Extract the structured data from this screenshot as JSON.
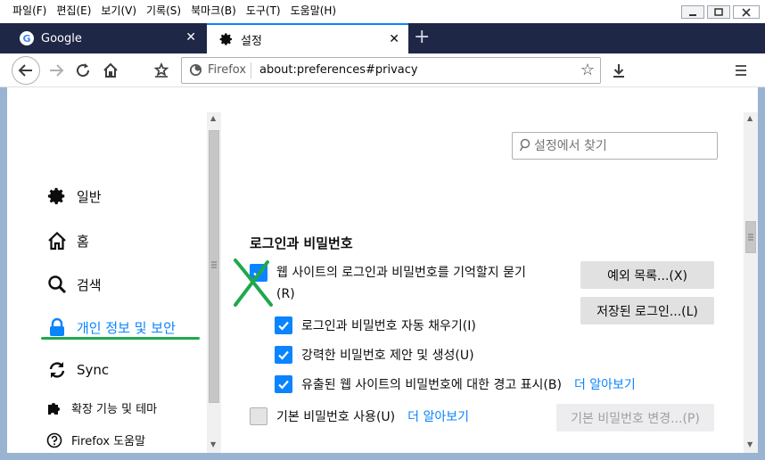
{
  "menubar": {
    "items": [
      "파일(F)",
      "편집(E)",
      "보기(V)",
      "기록(S)",
      "북마크(B)",
      "도구(T)",
      "도움말(H)"
    ]
  },
  "tabs": [
    {
      "label": "Google",
      "icon": "google-icon",
      "active": false
    },
    {
      "label": "설정",
      "icon": "gear-icon",
      "active": true
    }
  ],
  "urlbar": {
    "identity": "Firefox",
    "url": "about:preferences#privacy"
  },
  "sidebar": {
    "items": [
      {
        "label": "일반",
        "icon": "gear-icon"
      },
      {
        "label": "홈",
        "icon": "home-icon"
      },
      {
        "label": "검색",
        "icon": "search-icon"
      },
      {
        "label": "개인 정보 및 보안",
        "icon": "lock-icon",
        "selected": true
      },
      {
        "label": "Sync",
        "icon": "sync-icon"
      },
      {
        "label": "확장 기능 및 테마",
        "icon": "puzzle-icon"
      },
      {
        "label": "Firefox 도움말",
        "icon": "help-icon"
      }
    ]
  },
  "search": {
    "placeholder": "설정에서 찾기"
  },
  "logins": {
    "title": "로그인과 비밀번호",
    "ask_to_save": {
      "line1": "웹 사이트의 로그인과 비밀번호를 기억할지 묻기",
      "line2": "(R)",
      "checked": true
    },
    "autofill": {
      "label": "로그인과 비밀번호 자동 채우기(I)",
      "checked": true
    },
    "suggest": {
      "label": "강력한 비밀번호 제안 및 생성(U)",
      "checked": true
    },
    "breach": {
      "label": "유출된 웹 사이트의 비밀번호에 대한 경고 표시(B)",
      "checked": true,
      "link": "더 알아보기"
    },
    "primary_password": {
      "label": "기본 비밀번호 사용(U)",
      "checked": false,
      "link": "더 알아보기"
    },
    "exceptions_button": "예외 목록...(X)",
    "saved_logins_button": "저장된 로그인...(L)",
    "change_password_button": "기본 비밀번호 변경...(P)"
  },
  "colors": {
    "accent": "#0a84ff",
    "annotation_green": "#1fa84d",
    "tabstrip": "#1f2747"
  }
}
